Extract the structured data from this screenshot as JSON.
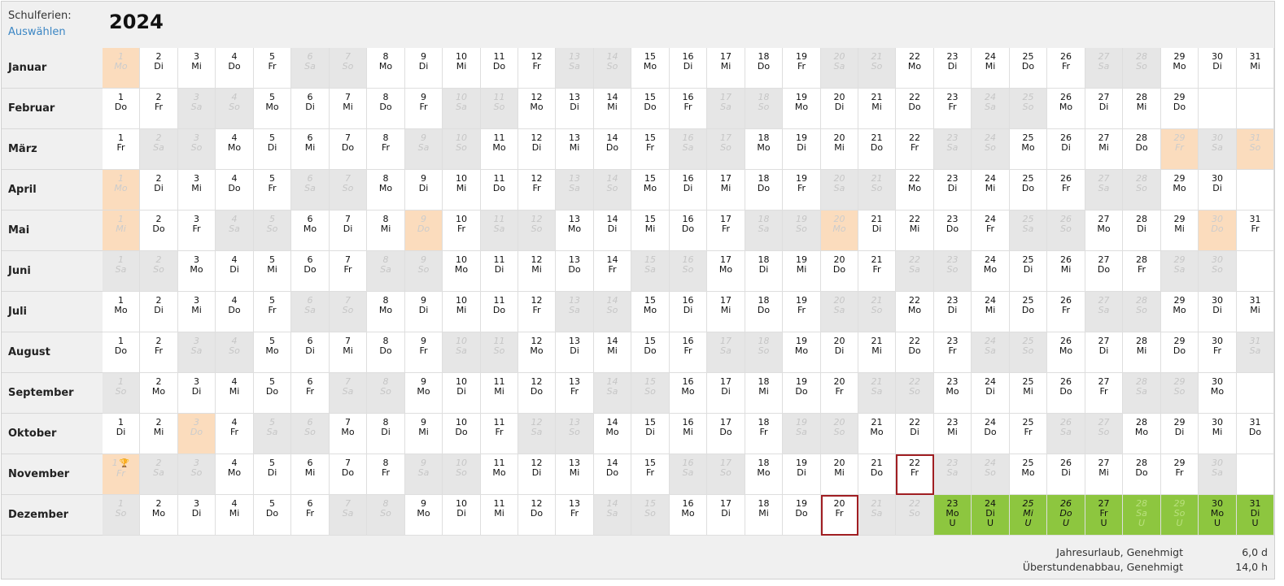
{
  "header": {
    "schulferien_label": "Schulferien:",
    "select_link": "Auswählen",
    "year": "2024"
  },
  "months": [
    {
      "name": "Januar",
      "start": 1,
      "days": 31,
      "hol": [
        1
      ],
      "sel": [],
      "vac": []
    },
    {
      "name": "Februar",
      "start": 4,
      "days": 29,
      "hol": [],
      "sel": [],
      "vac": []
    },
    {
      "name": "März",
      "start": 5,
      "days": 31,
      "hol": [
        29,
        31
      ],
      "sel": [],
      "vac": []
    },
    {
      "name": "April",
      "start": 1,
      "days": 30,
      "hol": [
        1
      ],
      "sel": [],
      "vac": []
    },
    {
      "name": "Mai",
      "start": 3,
      "days": 31,
      "hol": [
        1,
        9,
        20,
        30
      ],
      "sel": [],
      "vac": []
    },
    {
      "name": "Juni",
      "start": 6,
      "days": 30,
      "hol": [],
      "sel": [],
      "vac": []
    },
    {
      "name": "Juli",
      "start": 1,
      "days": 31,
      "hol": [],
      "sel": [],
      "vac": []
    },
    {
      "name": "August",
      "start": 4,
      "days": 31,
      "hol": [],
      "sel": [],
      "vac": []
    },
    {
      "name": "September",
      "start": 0,
      "days": 30,
      "hol": [],
      "sel": [],
      "vac": []
    },
    {
      "name": "Oktober",
      "start": 2,
      "days": 31,
      "hol": [
        3
      ],
      "sel": [],
      "vac": []
    },
    {
      "name": "November",
      "start": 5,
      "days": 30,
      "hol": [
        1
      ],
      "sel": [
        22
      ],
      "vac": [],
      "icon_day": 1
    },
    {
      "name": "Dezember",
      "start": 0,
      "days": 31,
      "hol": [],
      "sel": [
        20
      ],
      "vac": [
        23,
        24,
        25,
        26,
        27,
        28,
        29,
        30,
        31
      ]
    }
  ],
  "weekdays": [
    "So",
    "Mo",
    "Di",
    "Mi",
    "Do",
    "Fr",
    "Sa"
  ],
  "vacation_code": "U",
  "icons": {
    "holiday_marker": "trophy-icon"
  },
  "colors": {
    "holiday": "#fbdcbd",
    "weekend": "#e6e6e6",
    "vacation": "#8dc63f",
    "selected_border": "#a01e22",
    "link": "#3b86c4"
  },
  "footer": {
    "rows": [
      {
        "label": "Jahresurlaub, Genehmigt",
        "value": "6,0 d"
      },
      {
        "label": "Überstundenabbau, Genehmigt",
        "value": "14,0 h"
      }
    ]
  }
}
